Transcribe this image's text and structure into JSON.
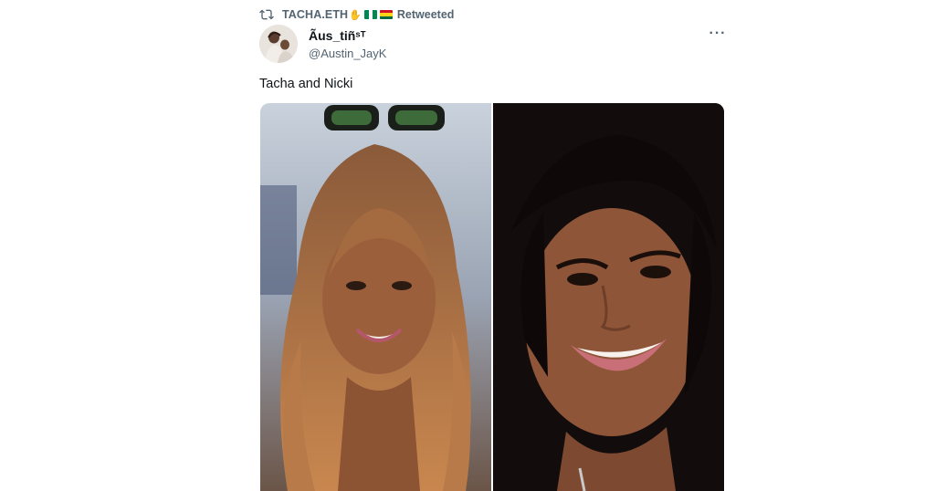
{
  "retweet": {
    "icon": "retweet-icon",
    "user": "TACHA.ETH",
    "emoji": "clapping-hands",
    "flags": [
      "nigeria-flag",
      "ghana-flag"
    ],
    "label": "Retweeted"
  },
  "author": {
    "display_name": "Ãus_tiñˢᵀ",
    "handle": "@Austin_JayK",
    "avatar": "avatar-photo"
  },
  "menu": {
    "more_label": "···"
  },
  "tweet": {
    "text": "Tacha and Nicki"
  },
  "media": {
    "images": [
      {
        "name": "photo-tacha",
        "subject": "woman with long wavy copper hair and sunglasses on head, smiling"
      },
      {
        "name": "photo-nicki",
        "subject": "woman with long black hair, smiling with pink lips"
      }
    ]
  },
  "colors": {
    "text_primary": "#0f1419",
    "text_secondary": "#536471",
    "background": "#ffffff"
  }
}
